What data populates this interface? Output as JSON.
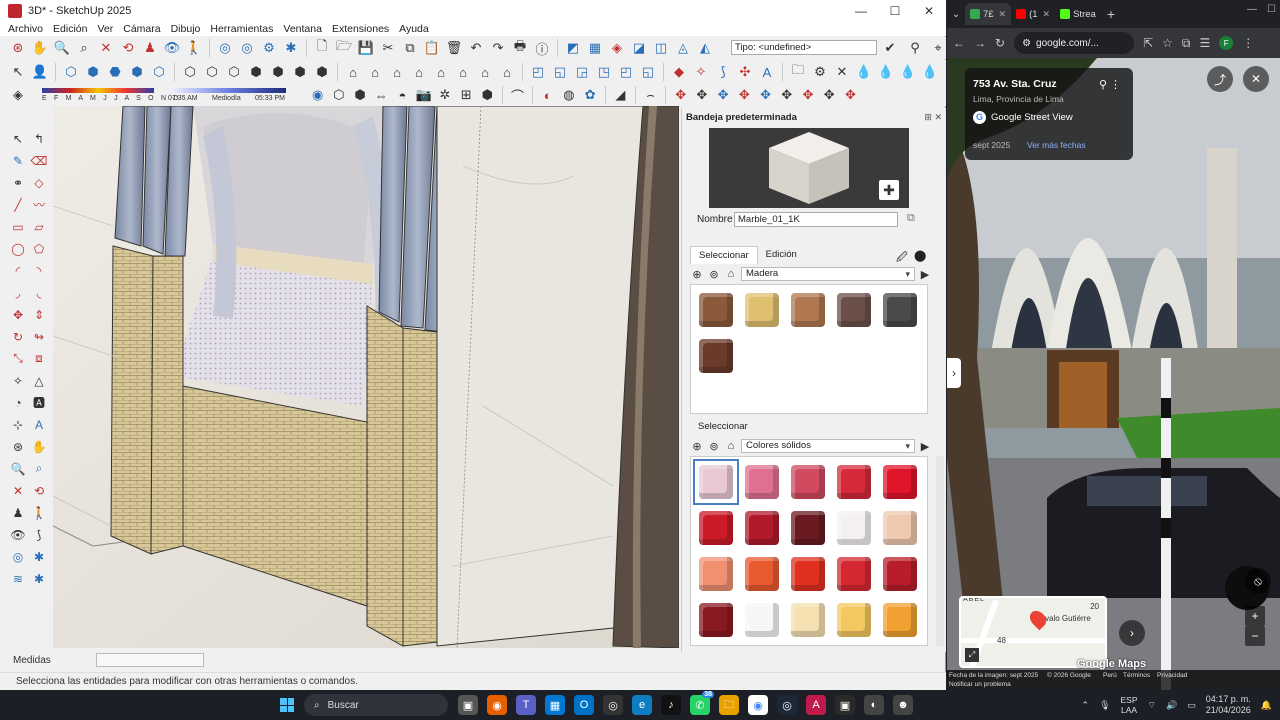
{
  "sketchup": {
    "title": "3D* - SketchUp 2025",
    "menu": [
      "Archivo",
      "Edición",
      "Ver",
      "Cámara",
      "Dibujo",
      "Herramientas",
      "Ventana",
      "Extensiones",
      "Ayuda"
    ],
    "tipo_field": "Tipo: <undefined>",
    "shadow": {
      "months": "E F M A M J J A S O N D",
      "time_start": "07:35 AM",
      "time_mid": "Mediodía",
      "time_end": "05:33 PM"
    },
    "measures_label": "Medidas",
    "status_text": "Selecciona las entidades para modificar con otras herramientas o comandos.",
    "tray": {
      "header": "Bandeja predeterminada",
      "name_label": "Nombre",
      "material_name": "Marble_01_1K",
      "tab_select": "Seleccionar",
      "tab_edit": "Edición",
      "library_top": "Madera",
      "panel2_tab": "Seleccionar",
      "library_bottom": "Colores sólidos",
      "wood_swatches": [
        "#8a5a3a",
        "#e0c070",
        "#b07850",
        "#6a5048",
        "#4a4a4a",
        "#6a3a2a"
      ],
      "solid_swatches": [
        "#e8c8d4",
        "#e07090",
        "#d04a60",
        "#d42a3a",
        "#e0142a",
        "#cc1a28",
        "#b01a2a",
        "#6a1a20",
        "#f4f0f0",
        "#f0c8b0",
        "#f09070",
        "#e85a30",
        "#e03020",
        "#d42830",
        "#b81e2a",
        "#8a1a22",
        "#f8f6f4",
        "#f4e0b0",
        "#f4c860",
        "#f0a030"
      ]
    }
  },
  "chrome": {
    "tabs": [
      {
        "label": "7£",
        "color": "#34a853"
      },
      {
        "label": "(1",
        "color": "#ff0000"
      },
      {
        "label": "Strea",
        "color": "#53fc18"
      }
    ],
    "url": "google.com/...",
    "avatar": "F",
    "streetview": {
      "address": "753 Av. Sta. Cruz",
      "city": "Lima, Provincia de Lima",
      "service": "Google Street View",
      "date": "sept 2025",
      "more_dates": "Ver más fechas",
      "map_place": "valo Gutiérre",
      "map_n20": "20",
      "map_n48": "48",
      "map_abel": "ABEL",
      "logo": "Google Maps",
      "footer_date": "Fecha de la imagen: sept 2025",
      "footer_copyright": "© 2026 Google",
      "footer_country": "Perú",
      "footer_terms": "Términos",
      "footer_privacy": "Privacidad",
      "footer_report": "Notificar un problema"
    }
  },
  "taskbar": {
    "search_placeholder": "Buscar",
    "lang_top": "ESP",
    "lang_bottom": "LAA",
    "time": "04:17 p. m.",
    "date": "21/04/2026",
    "whatsapp_badge": "38"
  }
}
